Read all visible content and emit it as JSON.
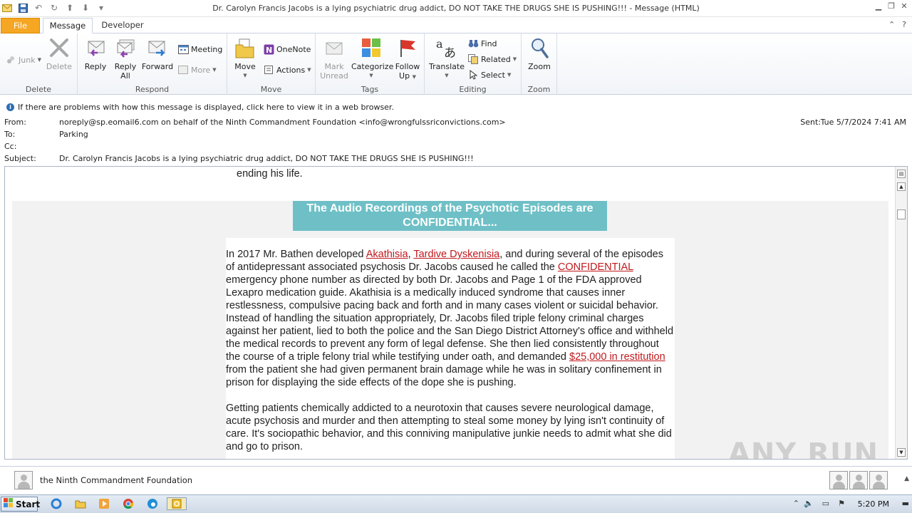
{
  "window": {
    "title": "Dr. Carolyn Francis Jacobs is a lying psychiatric drug addict, DO NOT TAKE THE DRUGS SHE IS PUSHING!!! - Message (HTML)"
  },
  "tabs": {
    "file": "File",
    "message": "Message",
    "developer": "Developer"
  },
  "ribbon": {
    "delete_group": {
      "label": "Delete",
      "junk": "Junk",
      "delete": "Delete"
    },
    "respond_group": {
      "label": "Respond",
      "reply": "Reply",
      "reply_all_1": "Reply",
      "reply_all_2": "All",
      "forward": "Forward",
      "meeting": "Meeting",
      "more": "More"
    },
    "move_group": {
      "label": "Move",
      "move": "Move",
      "onenote": "OneNote",
      "actions": "Actions"
    },
    "tags_group": {
      "label": "Tags",
      "mark_unread_1": "Mark",
      "mark_unread_2": "Unread",
      "categorize": "Categorize",
      "follow_up_1": "Follow",
      "follow_up_2": "Up"
    },
    "editing_group": {
      "label": "Editing",
      "translate": "Translate",
      "find": "Find",
      "related": "Related",
      "select": "Select"
    },
    "zoom_group": {
      "label": "Zoom",
      "zoom": "Zoom"
    }
  },
  "infobar": {
    "text": "If there are problems with how this message is displayed, click here to view it in a web browser."
  },
  "header": {
    "from_label": "From:",
    "from_value": "noreply@sp.eomail6.com on behalf of the Ninth Commandment Foundation <info@wrongfulssriconvictions.com>",
    "to_label": "To:",
    "to_value": "Parking",
    "cc_label": "Cc:",
    "subject_label": "Subject:",
    "subject_value": "Dr. Carolyn Francis Jacobs is a lying psychiatric drug addict, DO NOT TAKE THE DRUGS SHE IS PUSHING!!!",
    "sent_label": "Sent:",
    "sent_value": "Tue 5/7/2024 7:41 AM"
  },
  "body": {
    "ending": "ending his life.",
    "banner": "The Audio Recordings of the Psychotic Episodes are CONFIDENTIAL...",
    "p1": {
      "t1": "In 2017 Mr. Bathen developed ",
      "link_akathisia": "Akathisia",
      "t2": ", ",
      "link_tardive": "Tardive Dyskenisia",
      "t3": ", and during several of the episodes of antidepressant associated psychosis Dr. Jacobs caused he called the ",
      "link_confidential": "CONFIDENTIAL",
      "t4": " emergency phone number as directed by both Dr. Jacobs and Page 1 of the FDA approved Lexapro medication guide. Akathisia is a medically induced syndrome that causes inner restlessness, compulsive pacing back and forth and in many cases violent or suicidal behavior. Instead of handling the situation appropriately, Dr. Jacobs filed triple felony criminal charges against her patient, lied to both the police and the San Diego District Attorney's office and withheld the medical records to prevent any form of legal defense. She then lied consistently throughout the course of a triple felony trial while testifying under oath, and demanded ",
      "link_restitution": "$25,000 in restitution",
      "t5": " from the patient she had given permanent brain damage while he was in solitary confinement in prison for displaying the side effects of the dope she is pushing."
    },
    "p2": "Getting patients chemically addicted to a neurotoxin that causes severe neurological damage, acute psychosis and murder and then attempting to steal some money by lying isn't continuity of care. It's sociopathic behavior, and this conniving manipulative junkie needs to admit what she did and go to prison."
  },
  "people_pane": {
    "name": "the Ninth Commandment Foundation"
  },
  "taskbar": {
    "start": "Start",
    "clock": "5:20 PM"
  },
  "watermark": "ANY RUN"
}
